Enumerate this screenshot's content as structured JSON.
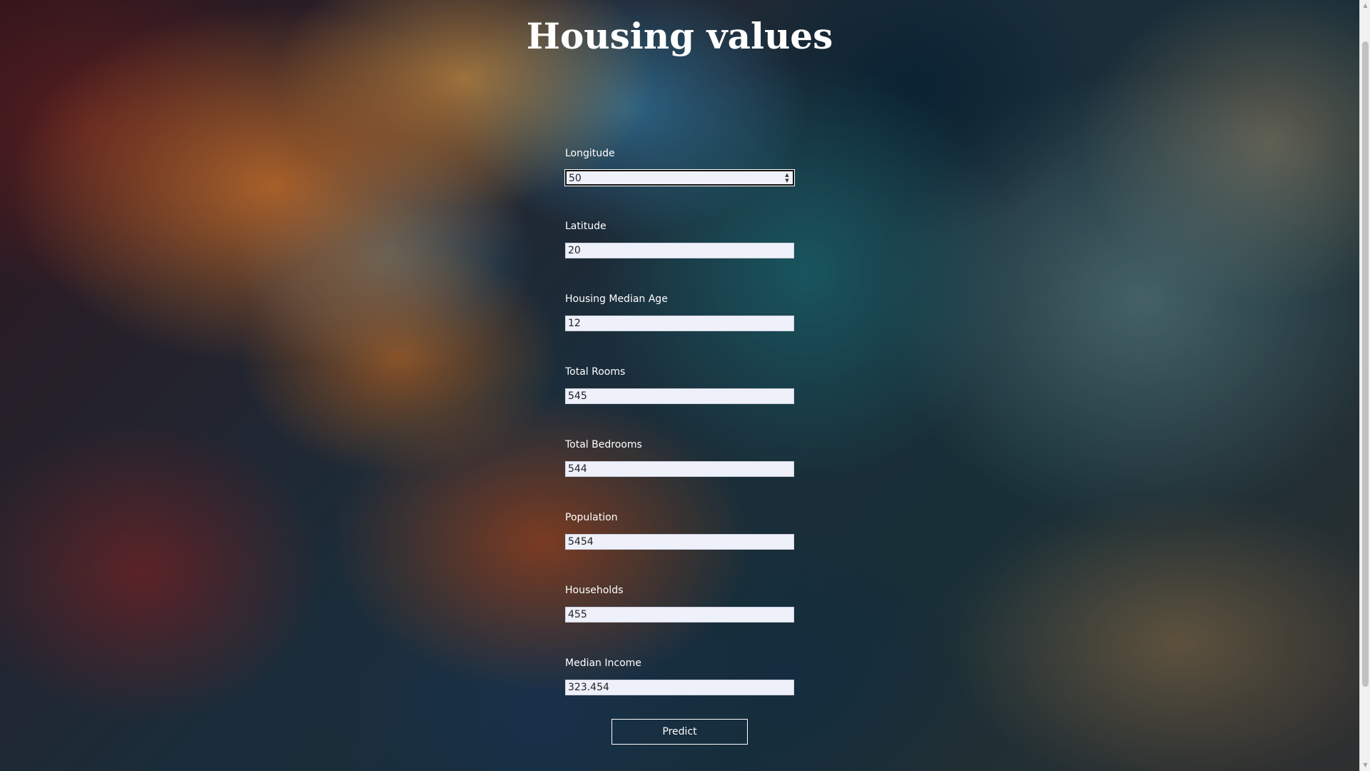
{
  "page": {
    "title": "Housing values"
  },
  "form": {
    "fields": [
      {
        "label": "Longitude",
        "value": "50",
        "focused": true
      },
      {
        "label": "Latitude",
        "value": "20"
      },
      {
        "label": "Housing Median Age",
        "value": "12"
      },
      {
        "label": "Total Rooms",
        "value": "545"
      },
      {
        "label": "Total Bedrooms",
        "value": "544"
      },
      {
        "label": "Population",
        "value": "5454"
      },
      {
        "label": "Households",
        "value": "455"
      },
      {
        "label": "Median Income",
        "value": "323.454"
      }
    ],
    "submit_label": "Predict"
  },
  "icons": {
    "spinner": "number-spinner-icon",
    "scroll_up": "scroll-up-arrow-icon",
    "scroll_down": "scroll-down-arrow-icon"
  },
  "colors": {
    "text": "#ffffff",
    "input_bg": "#eef0fa"
  }
}
